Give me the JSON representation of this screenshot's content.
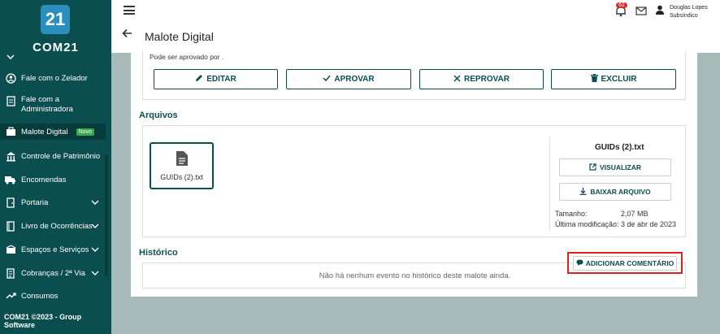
{
  "app": {
    "logo_number": "21",
    "logo_name": "COM21",
    "footer": "COM21 ©2023 - Group Software"
  },
  "sidebar": {
    "items": [
      {
        "label": "Fale com o Zelador"
      },
      {
        "label": "Fale com a Administradora"
      },
      {
        "label": "Malote Digital",
        "badge": "Novo"
      },
      {
        "label": "Controle de Patrimônio"
      },
      {
        "label": "Encomendas"
      },
      {
        "label": "Portaria"
      },
      {
        "label": "Livro de Ocorrências"
      },
      {
        "label": "Espaços e Serviços"
      },
      {
        "label": "Cobranças / 2ª Via"
      },
      {
        "label": "Consumos"
      }
    ]
  },
  "header": {
    "title": "Malote Digital",
    "notification_count": "62",
    "user_name": "Douglas Lopes",
    "user_role": "Subsíndico"
  },
  "approval": {
    "text": "Pode ser aprovado por .",
    "buttons": {
      "edit": "EDITAR",
      "approve": "APROVAR",
      "reject": "REPROVAR",
      "delete": "EXCLUIR"
    }
  },
  "files": {
    "section_title": "Arquivos",
    "file_name": "GUIDs (2).txt",
    "detail_title": "GUIDs (2).txt",
    "view_button": "VISUALIZAR",
    "download_button": "BAIXAR ARQUIVO",
    "size_label": "Tamanho:",
    "size_value": "2,07 MB",
    "modified_label": "Última modificação:",
    "modified_value": "3 de abr de 2023"
  },
  "history": {
    "section_title": "Histórico",
    "empty_text": "Não há nenhum evento no histórico deste malote ainda.",
    "add_comment_button": "ADICIONAR COMENTÁRIO"
  },
  "colors": {
    "sidebar_bg": "#0b4e4f",
    "accent": "#0b4e4f",
    "badge_green": "#37a94a",
    "highlight_red": "#e0201c",
    "notification_red": "#d32f2f"
  }
}
